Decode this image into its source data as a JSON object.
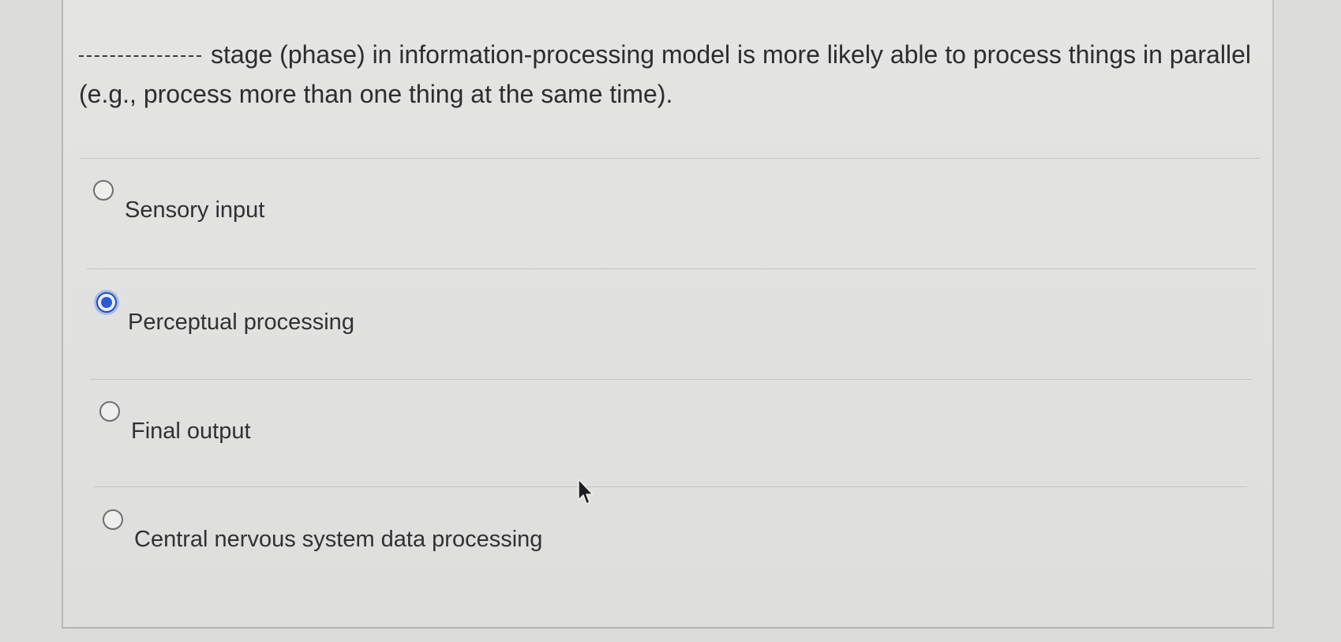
{
  "question": {
    "blank": "__________",
    "text": "stage (phase) in information-processing model is more likely able to process things in parallel (e.g., process more than one thing at the same time)."
  },
  "options": [
    {
      "label": "Sensory input",
      "selected": false
    },
    {
      "label": "Perceptual processing",
      "selected": true
    },
    {
      "label": "Final output",
      "selected": false
    },
    {
      "label": "Central nervous system data processing",
      "selected": false
    }
  ],
  "colors": {
    "accent": "#2a5bd7",
    "background": "#e2e2e0",
    "text": "#2d2f33"
  },
  "icons": {
    "cursor": "mouse-pointer-icon"
  }
}
